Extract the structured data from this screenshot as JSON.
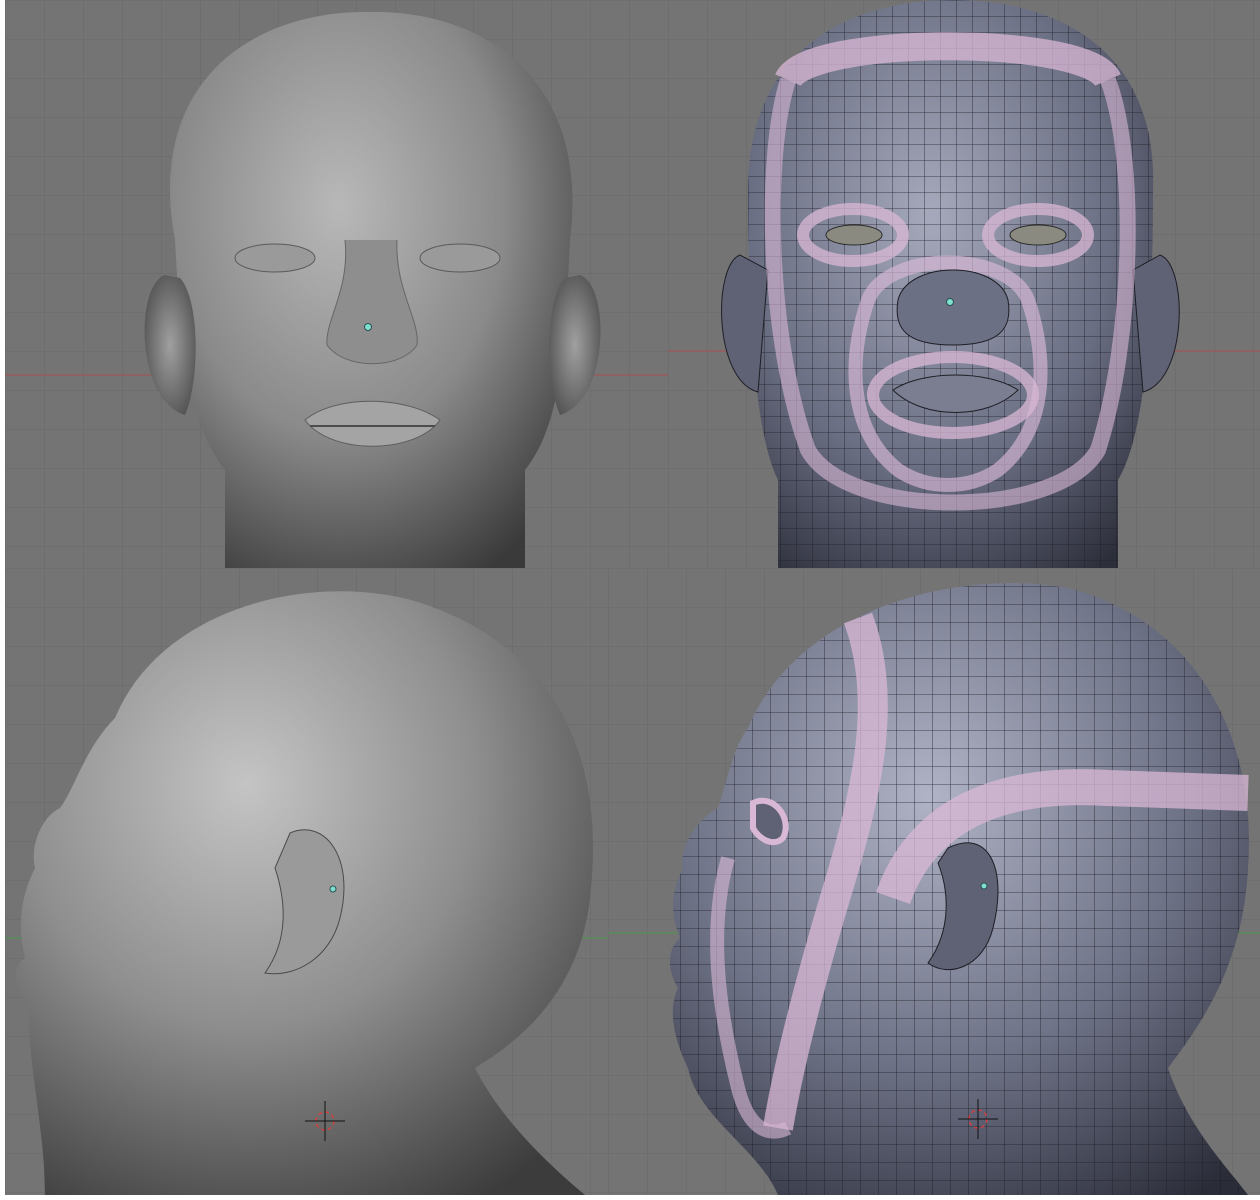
{
  "viewports": [
    {
      "id": "front-solid",
      "view": "front",
      "shading": "solid",
      "wire": false
    },
    {
      "id": "front-wire",
      "view": "front",
      "shading": "solid",
      "wire": true
    },
    {
      "id": "side-solid",
      "view": "side",
      "shading": "solid",
      "wire": false
    },
    {
      "id": "side-wire",
      "view": "side",
      "shading": "solid",
      "wire": true
    }
  ],
  "colors": {
    "grid_bg": "#747474",
    "grid_line": "#6a6a6a",
    "grid_major": "#5e5e5e",
    "x_axis": "#b24a4a",
    "y_axis": "#4a9a4a",
    "solid_mesh": "#8a8a8a",
    "wire_mesh": "#6c6f80",
    "edge_loop": "#d9b8d6",
    "edge_line": "#e6d27a",
    "vertex_dot": "#7fe0d0"
  },
  "icons": [
    "3d-cursor-icon",
    "object-origin-icon"
  ]
}
